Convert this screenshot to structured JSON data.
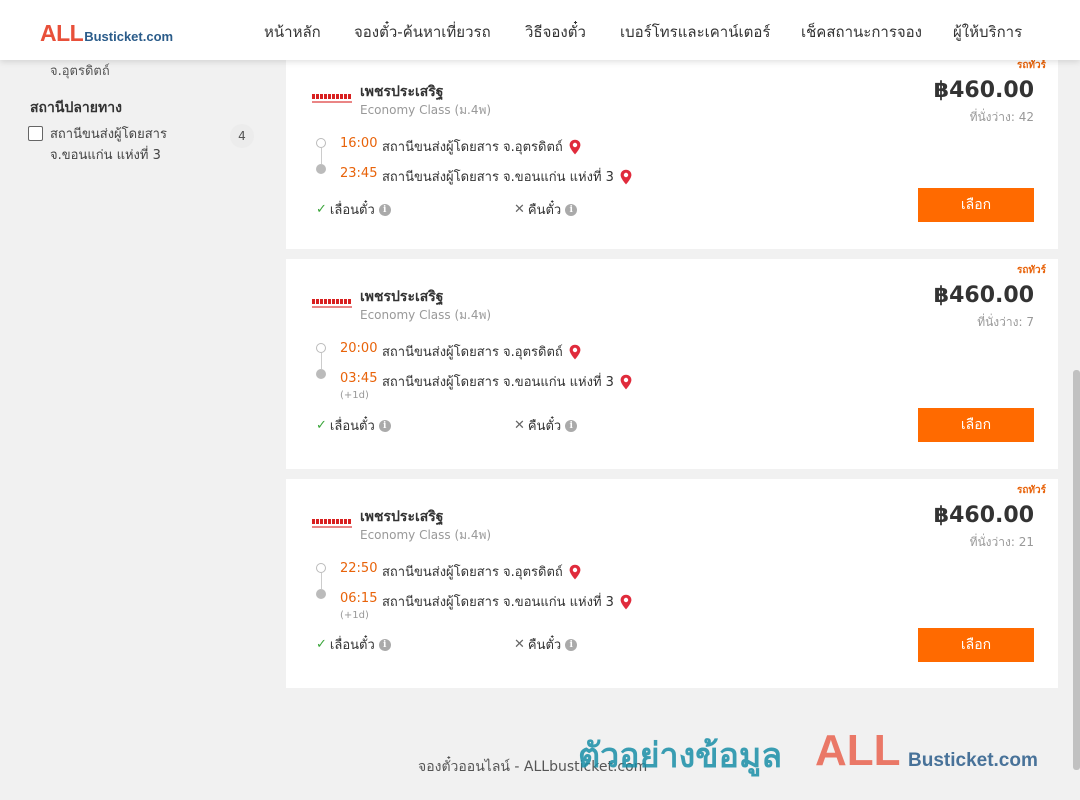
{
  "header": {
    "logo": {
      "all": "ALL",
      "rest": "Busticket.com"
    },
    "nav": [
      "หน้าหลัก",
      "จองตั๋ว-ค้นหาเที่ยวรถ",
      "วิธีจองตั๋ว",
      "เบอร์โทรและเคาน์เตอร์",
      "เช็คสถานะการจอง",
      "ผู้ให้บริการ"
    ]
  },
  "sidebar": {
    "cut_text": "จ.อุตรดิตถ์",
    "destination_heading": "สถานีปลายทาง",
    "filters": [
      {
        "label_line1": "สถานีขนส่งผู้โดยสาร",
        "label_line2": "จ.ขอนแก่น แห่งที่ 3",
        "count": "4",
        "checked": false
      }
    ]
  },
  "trips": [
    {
      "tag": "รถทัวร์",
      "operator": "เพชรประเสริฐ",
      "class": "Economy Class (ม.4พ)",
      "price": "฿460.00",
      "seats": "ที่นั่งว่าง: 42",
      "depart_time": "16:00",
      "depart_station": "สถานีขนส่งผู้โดยสาร จ.อุตรดิตถ์",
      "arrive_time": "23:45",
      "arrive_station": "สถานีขนส่งผู้โดยสาร จ.ขอนแก่น แห่งที่ 3",
      "plus_day": "",
      "perk_change": "เลื่อนตั๋ว",
      "perk_refund": "คืนตั๋ว",
      "select_label": "เลือก"
    },
    {
      "tag": "รถทัวร์",
      "operator": "เพชรประเสริฐ",
      "class": "Economy Class (ม.4พ)",
      "price": "฿460.00",
      "seats": "ที่นั่งว่าง: 7",
      "depart_time": "20:00",
      "depart_station": "สถานีขนส่งผู้โดยสาร จ.อุตรดิตถ์",
      "arrive_time": "03:45",
      "arrive_station": "สถานีขนส่งผู้โดยสาร จ.ขอนแก่น แห่งที่ 3",
      "plus_day": "(+1d)",
      "perk_change": "เลื่อนตั๋ว",
      "perk_refund": "คืนตั๋ว",
      "select_label": "เลือก"
    },
    {
      "tag": "รถทัวร์",
      "operator": "เพชรประเสริฐ",
      "class": "Economy Class (ม.4พ)",
      "price": "฿460.00",
      "seats": "ที่นั่งว่าง: 21",
      "depart_time": "22:50",
      "depart_station": "สถานีขนส่งผู้โดยสาร จ.อุตรดิตถ์",
      "arrive_time": "06:15",
      "arrive_station": "สถานีขนส่งผู้โดยสาร จ.ขอนแก่น แห่งที่ 3",
      "plus_day": "(+1d)",
      "perk_change": "เลื่อนตั๋ว",
      "perk_refund": "คืนตั๋ว",
      "select_label": "เลือก"
    }
  ],
  "footer": {
    "text": "จองตั๋วออนไลน์ - ALLbusticket.com",
    "watermark_text": "ตัวอย่างข้อมูล",
    "watermark_logo_all": "ALL",
    "watermark_logo_rest": "Busticket.com"
  },
  "colors": {
    "accent": "#ff6a00",
    "time": "#e8630a",
    "brand_red": "#e8503a",
    "brand_blue": "#2b5c8a",
    "pin": "#e02b3c"
  }
}
